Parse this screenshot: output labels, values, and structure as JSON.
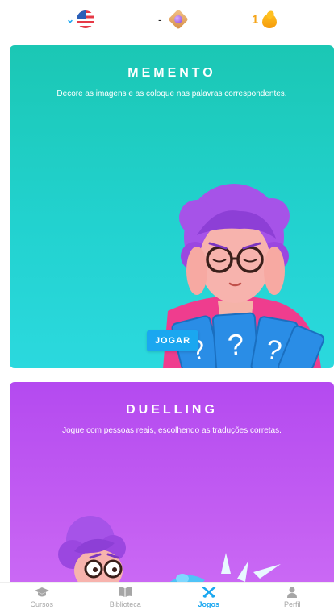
{
  "header": {
    "language": {
      "flag": "us-flag-icon",
      "chevron": "chevron-down-icon"
    },
    "gems": {
      "value": "-",
      "icon": "gem-icon"
    },
    "streak": {
      "value": "1",
      "icon": "flame-icon"
    }
  },
  "games": [
    {
      "title": "MEMENTO",
      "description": "Decore as imagens e as coloque nas palavras correspondentes.",
      "button_label": "JOGAR",
      "accent": "#1bc7b4"
    },
    {
      "title": "DUELLING",
      "description": "Jogue com pessoas reais, escolhendo as traduções corretas.",
      "accent": "#b44af0"
    }
  ],
  "nav": {
    "items": [
      {
        "label": "Cursos",
        "icon": "graduation-cap-icon",
        "active": false
      },
      {
        "label": "Biblioteca",
        "icon": "book-icon",
        "active": false
      },
      {
        "label": "Jogos",
        "icon": "swords-icon",
        "active": true
      },
      {
        "label": "Perfil",
        "icon": "user-icon",
        "active": false
      }
    ],
    "active_color": "#1aa7f0",
    "inactive_color": "#a6a6a6"
  }
}
